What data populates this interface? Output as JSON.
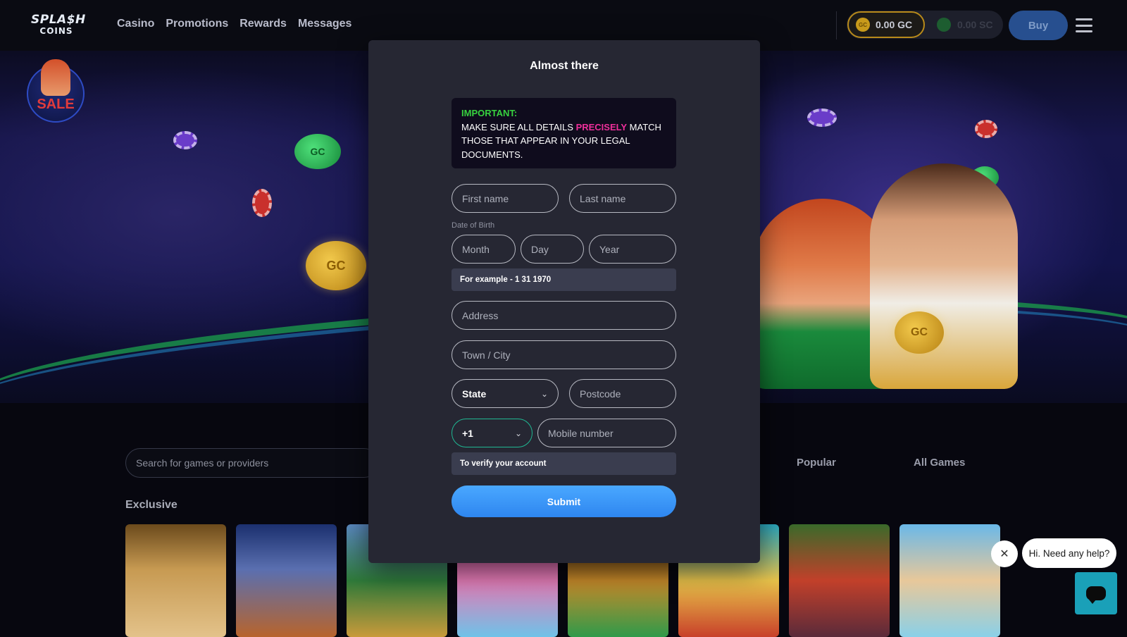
{
  "header": {
    "logo_line1": "SPLA$H",
    "logo_line2": "COINS",
    "nav": [
      "Casino",
      "Promotions",
      "Rewards",
      "Messages"
    ],
    "gc_balance": "0.00 GC",
    "sc_balance": "0.00 SC",
    "gc_coin_label": "GC",
    "buy_label": "Buy"
  },
  "hero": {
    "sale_label": "SALE",
    "coin_label": "GC"
  },
  "modal": {
    "title": "Almost there",
    "notice": {
      "heading": "IMPORTANT:",
      "text_before": "MAKE SURE ALL DETAILS ",
      "highlight": "PRECISELY",
      "text_after": " MATCH THOSE THAT APPEAR IN YOUR LEGAL DOCUMENTS."
    },
    "first_name_placeholder": "First name",
    "last_name_placeholder": "Last name",
    "dob_label": "Date of Birth",
    "month_placeholder": "Month",
    "day_placeholder": "Day",
    "year_placeholder": "Year",
    "dob_hint": "For example - 1 31 1970",
    "address_placeholder": "Address",
    "city_placeholder": "Town / City",
    "state_value": "State",
    "postcode_placeholder": "Postcode",
    "country_code": "+1",
    "mobile_placeholder": "Mobile number",
    "mobile_hint": "To verify your account",
    "submit_label": "Submit"
  },
  "games": {
    "search_placeholder": "Search for games or providers",
    "tabs": [
      "Popular",
      "All Games"
    ],
    "section_title": "Exclusive"
  },
  "chat": {
    "bubble_text": "Hi. Need any help?"
  },
  "colors": {
    "accent_blue": "#2e86f0",
    "important_green": "#37d23f",
    "highlight_pink": "#ef2f9b",
    "teal_border": "#1fb892"
  }
}
